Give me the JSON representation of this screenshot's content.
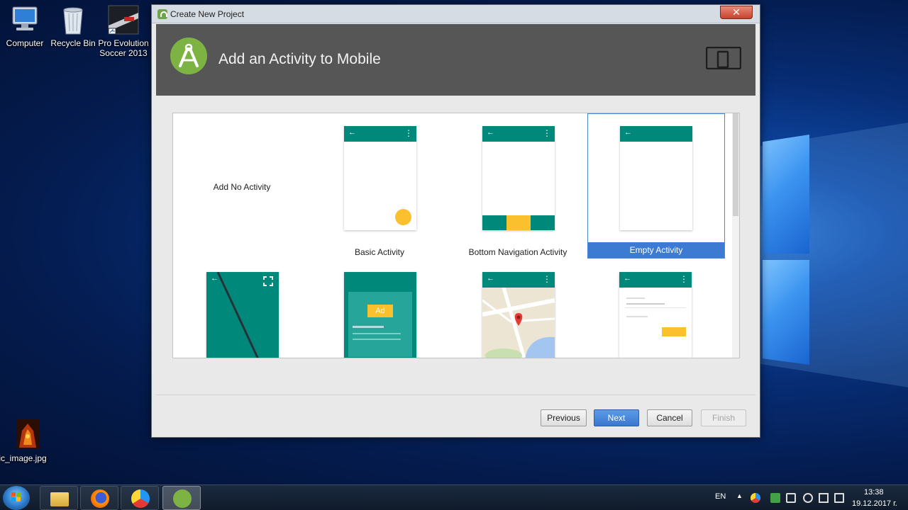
{
  "desktop": {
    "icons": [
      {
        "label": "Computer"
      },
      {
        "label": "Recycle Bin"
      },
      {
        "label": "Pro Evolution Soccer 2013"
      },
      {
        "label": "ic_image.jpg"
      }
    ]
  },
  "dialog": {
    "window_title": "Create New Project",
    "close_label": "✕",
    "header_title": "Add an Activity to Mobile",
    "activities": [
      {
        "label": "Add No Activity",
        "selected": false
      },
      {
        "label": "Basic Activity",
        "selected": false
      },
      {
        "label": "Bottom Navigation Activity",
        "selected": false
      },
      {
        "label": "Empty Activity",
        "selected": true
      },
      {
        "label": "",
        "selected": false
      },
      {
        "label": "",
        "selected": false
      },
      {
        "label": "",
        "selected": false
      },
      {
        "label": "",
        "selected": false
      }
    ],
    "ad_badge": "Ad",
    "buttons": {
      "previous": "Previous",
      "next": "Next",
      "cancel": "Cancel",
      "finish": "Finish"
    }
  },
  "taskbar": {
    "language": "EN",
    "time": "13:38",
    "date": "19.12.2017 г."
  },
  "colors": {
    "teal": "#00897b",
    "accent_yellow": "#fbc02d",
    "selection_blue": "#3d7ad1",
    "android_green": "#7cb342"
  }
}
